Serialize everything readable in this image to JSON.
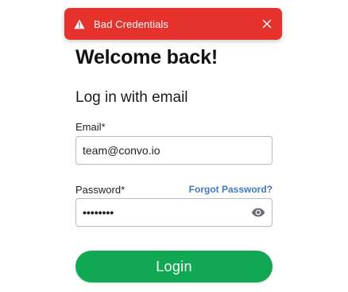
{
  "toast": {
    "message": "Bad Credentials",
    "icon": "warning-triangle-icon",
    "close_icon": "close-icon",
    "color": "#e5322d"
  },
  "page": {
    "title": "Welcome back!",
    "subtitle": "Log in with email"
  },
  "form": {
    "email_label": "Email*",
    "email_value": "team@convo.io",
    "password_label": "Password*",
    "password_masked": "••••••••",
    "forgot_link": "Forgot Password?",
    "login_button": "Login",
    "eye_icon": "eye-icon"
  },
  "colors": {
    "accent_green": "#10a852",
    "link_blue": "#3f79bf",
    "error_red": "#e5322d"
  }
}
